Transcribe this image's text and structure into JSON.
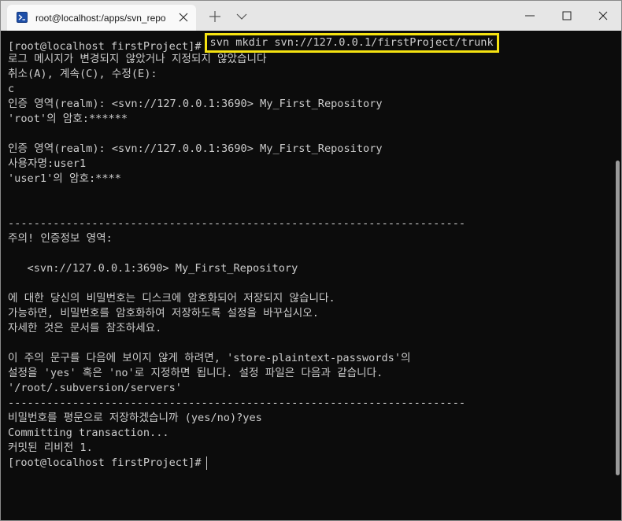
{
  "window": {
    "tab_title": "root@localhost:/apps/svn_repo",
    "colors": {
      "terminal_bg": "#0c0c0c",
      "terminal_fg": "#cccccc",
      "highlight_border": "#f5e211",
      "titlebar_bg": "#e6e6e6"
    },
    "icons": {
      "tab_icon": "terminal-icon",
      "close": "close-icon",
      "new_tab": "plus-icon",
      "dropdown": "chevron-down-icon",
      "minimize": "minimize-icon",
      "maximize": "maximize-icon",
      "window_close": "close-icon"
    }
  },
  "terminal": {
    "prompt": "[root@localhost firstProject]#",
    "command": "svn mkdir svn://127.0.0.1/firstProject/trunk",
    "lines": [
      "로그 메시지가 변경되지 않았거나 지정되지 않았습니다",
      "취소(A), 계속(C), 수정(E):",
      "c",
      "인증 영역(realm): <svn://127.0.0.1:3690> My_First_Repository",
      "'root'의 암호:******",
      "",
      "인증 영역(realm): <svn://127.0.0.1:3690> My_First_Repository",
      "사용자명:user1",
      "'user1'의 암호:****",
      "",
      "",
      "-----------------------------------------------------------------------",
      "주의! 인증정보 영역:",
      "",
      "   <svn://127.0.0.1:3690> My_First_Repository",
      "",
      "에 대한 당신의 비밀번호는 디스크에 암호화되어 저장되지 않습니다.",
      "가능하면, 비밀번호를 암호화하여 저장하도록 설정을 바꾸십시오.",
      "자세한 것은 문서를 참조하세요.",
      "",
      "이 주의 문구를 다음에 보이지 않게 하려면, 'store-plaintext-passwords'의",
      "설정을 'yes' 혹은 'no'로 지정하면 됩니다. 설정 파일은 다음과 같습니다.",
      "'/root/.subversion/servers'",
      "-----------------------------------------------------------------------",
      "비밀번호를 평문으로 저장하겠습니까 (yes/no)?yes",
      "Committing transaction...",
      "커밋된 리비전 1."
    ],
    "final_prompt": "[root@localhost firstProject]#"
  }
}
